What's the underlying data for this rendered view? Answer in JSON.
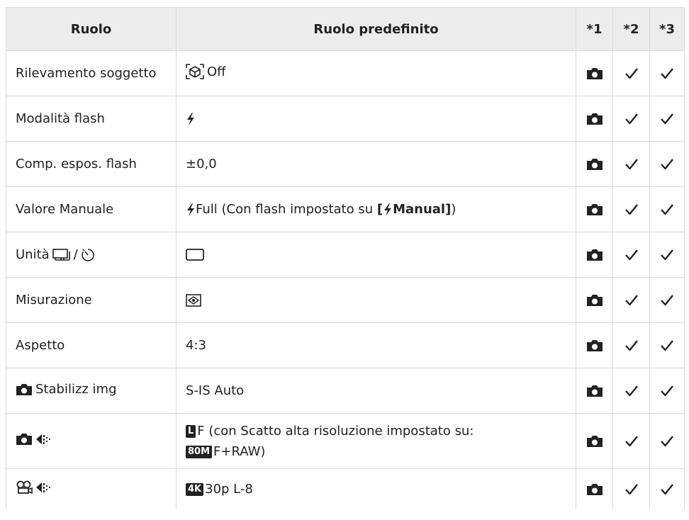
{
  "header": {
    "col_role": "Ruolo",
    "col_default": "Ruolo predefinito",
    "col_1": "*1",
    "col_2": "*2",
    "col_3": "*3"
  },
  "rows": [
    {
      "role": "Rilevamento soggetto",
      "value": "Off",
      "c1": "camera-icon",
      "c2": "check-icon",
      "c3": "check-icon"
    },
    {
      "role": "Modalità flash",
      "value": "",
      "c1": "camera-icon",
      "c2": "check-icon",
      "c3": "check-icon"
    },
    {
      "role": "Comp. espos. flash",
      "value": "±0,0",
      "c1": "camera-icon",
      "c2": "check-icon",
      "c3": "check-icon"
    },
    {
      "role": "Valore Manuale",
      "value_prefix": "Full (Con flash impostato su ",
      "value_bracket_open": "[",
      "value_bold": "Manual",
      "value_bracket_close": "]",
      "value_suffix": ")",
      "c1": "camera-icon",
      "c2": "check-icon",
      "c3": "check-icon"
    },
    {
      "role_prefix": "Unità ",
      "role_sep": "/",
      "value": "",
      "c1": "camera-icon",
      "c2": "check-icon",
      "c3": "check-icon"
    },
    {
      "role": "Misurazione",
      "value": "",
      "c1": "camera-icon",
      "c2": "check-icon",
      "c3": "check-icon"
    },
    {
      "role": "Aspetto",
      "value": "4:3",
      "c1": "camera-icon",
      "c2": "check-icon",
      "c3": "check-icon"
    },
    {
      "role": "Stabilizz img",
      "value": "S-IS Auto",
      "c1": "camera-icon",
      "c2": "check-icon",
      "c3": "check-icon"
    },
    {
      "role": "",
      "value_line1_badge": "L",
      "value_line1": "F (con Scatto alta risoluzione impostato su:",
      "value_line2_badge": "80M",
      "value_line2": "F+RAW)",
      "c1": "camera-icon",
      "c2": "check-icon",
      "c3": "check-icon"
    },
    {
      "role": "",
      "value_badge": "4K",
      "value": "30p L-8",
      "c1": "camera-icon",
      "c2": "check-icon",
      "c3": "check-icon"
    }
  ]
}
